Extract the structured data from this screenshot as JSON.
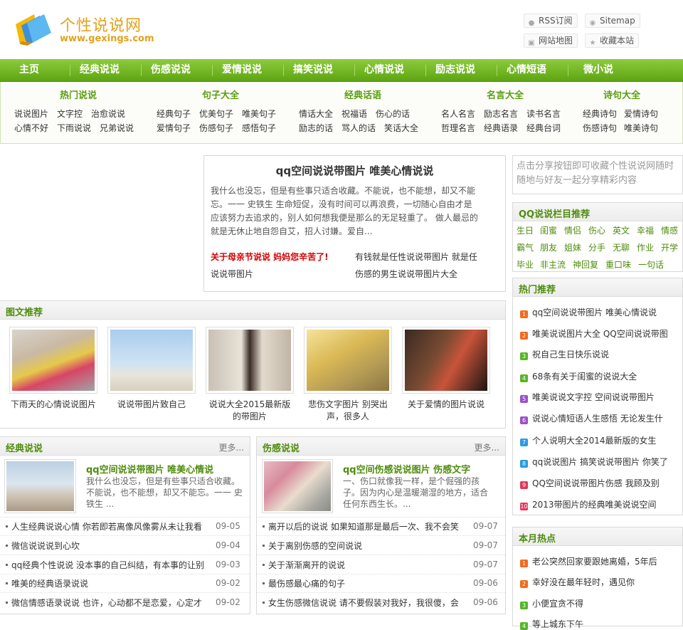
{
  "logo": {
    "title": "个性说说网",
    "url": "www.gexings.com"
  },
  "header_links": {
    "rss": "RSS订阅",
    "sitemap": "Sitemap",
    "map": "网站地图",
    "favorite": "收藏本站"
  },
  "nav": [
    "主页",
    "经典说说",
    "伤感说说",
    "爱情说说",
    "搞笑说说",
    "心情说说",
    "励志说说",
    "心情短语",
    "微小说"
  ],
  "subnav": [
    {
      "title": "热门说说",
      "links": [
        "说说图片",
        "文字控",
        "治愈说说",
        "心情不好",
        "下雨说说",
        "兄弟说说"
      ]
    },
    {
      "title": "句子大全",
      "links": [
        "经典句子",
        "优美句子",
        "唯美句子",
        "爱情句子",
        "伤感句子",
        "感悟句子"
      ]
    },
    {
      "title": "经典话语",
      "links": [
        "情话大全",
        "祝福语",
        "伤心的话",
        "励志的话",
        "骂人的话",
        "笑话大全"
      ]
    },
    {
      "title": "名言大全",
      "links": [
        "名人名言",
        "励志名言",
        "读书名言",
        "哲理名言",
        "经典语录",
        "经典台词"
      ]
    },
    {
      "title": "诗句大全",
      "links": [
        "经典诗句",
        "爱情诗句",
        "伤感诗句",
        "唯美诗句"
      ]
    }
  ],
  "headline": {
    "title": "qq空间说说带图片 唯美心情说说",
    "text": "我什么也没忘，但是有些事只适合收藏。不能说，也不能想，却又不能忘。一一 史铁生 生命短促，没有时间可以再浪费，一切随心自由才是应该努力去追求的，别人如何想我便是那么的无足轻重了。 做人最忌的就是无休止地自怨自艾，招人讨嫌。爱自...",
    "link_red": "关于母亲节说说 妈妈您辛苦了!",
    "link2": "有钱就是任性说说带图片 就是任",
    "link3": "说说带图片",
    "link4": "伤感的男生说说带图片大全"
  },
  "share_tip": "点击分享按钮即可收藏个性说说网随时随地与好友一起分享精彩内容",
  "qq_column": {
    "title": "QQ说说栏目推荐",
    "tags": [
      "生日",
      "闺蜜",
      "情侣",
      "伤心",
      "英文",
      "幸福",
      "情感",
      "霸气",
      "朋友",
      "姐妹",
      "分手",
      "无聊",
      "作业",
      "开学",
      "毕业",
      "非主流",
      "神回复",
      "重口味",
      "一句话"
    ]
  },
  "hot": {
    "title": "热门推荐",
    "items": [
      {
        "n": "1",
        "text": "qq空间说说带图片 唯美心情说说"
      },
      {
        "n": "2",
        "text": "唯美说说图片大全 QQ空间说说带图"
      },
      {
        "n": "3",
        "text": "祝自己生日快乐说说"
      },
      {
        "n": "4",
        "text": "68条有关于闺蜜的说说大全"
      },
      {
        "n": "5",
        "text": "唯美说说文字控 空间说说带图片"
      },
      {
        "n": "6",
        "text": "说说心情短语人生感悟 无论发生什"
      },
      {
        "n": "7",
        "text": "个人说明大全2014最新版的女生"
      },
      {
        "n": "8",
        "text": "qq说说图片 搞笑说说带图片 你笑了"
      },
      {
        "n": "9",
        "text": "QQ空间说说带图片伤感 我顾及别"
      },
      {
        "n": "10",
        "text": "2013带图片的经典唯美说说空间"
      }
    ]
  },
  "month_hot": {
    "title": "本月热点",
    "items": [
      {
        "n": "1",
        "text": "老公突然回家要跟她离婚，5年后"
      },
      {
        "n": "2",
        "text": "幸好没在最年轻时，遇见你"
      },
      {
        "n": "3",
        "text": "小便宜贪不得"
      },
      {
        "n": "4",
        "text": "等上城东下午"
      }
    ]
  },
  "pictures": {
    "title": "图文推荐",
    "items": [
      "下雨天的心情说说图片",
      "说说带图片致自己",
      "说说大全2015最新版的带图片",
      "悲伤文字图片 别哭出声，很多人",
      "关于爱情的图片说说"
    ]
  },
  "classic": {
    "title": "经典说说",
    "more": "更多...",
    "feature_title": "qq空间说说带图片 唯美心情说",
    "feature_text": "我什么也没忘，但是有些事只适合收藏。不能说，也不能想，却又不能忘。一一 史铁生 ...",
    "items": [
      {
        "text": "人生经典说说心情 你若即若离像风像雾从未让我看",
        "date": "09-05"
      },
      {
        "text": "微信说说说到心坎",
        "date": "09-04"
      },
      {
        "text": "qq经典个性说说 没本事的自己纠结，有本事的让别",
        "date": "09-03"
      },
      {
        "text": "唯美的经典语录说说",
        "date": "09-02"
      },
      {
        "text": "微信情感语录说说 也许，心动都不是恋爱，心定才",
        "date": "09-02"
      }
    ]
  },
  "sad": {
    "title": "伤感说说",
    "more": "更多...",
    "feature_title": "qq空间伤感说说图片 伤感文字",
    "feature_text": "一、伤口就像我一样，是个倔强的孩子。因为内心是温暖潮湿的地方，适合任何东西生长。...",
    "items": [
      {
        "text": "离开以后的说说 如果知道那是最后一次、我不会笑",
        "date": "09-07"
      },
      {
        "text": "关于离别伤感的空间说说",
        "date": "09-07"
      },
      {
        "text": "关于渐渐离开的说说",
        "date": "09-07"
      },
      {
        "text": "最伤感最心痛的句子",
        "date": "09-06"
      },
      {
        "text": "女生伤感微信说说 请不要假装对我好，我很傻，会",
        "date": "09-06"
      }
    ]
  }
}
